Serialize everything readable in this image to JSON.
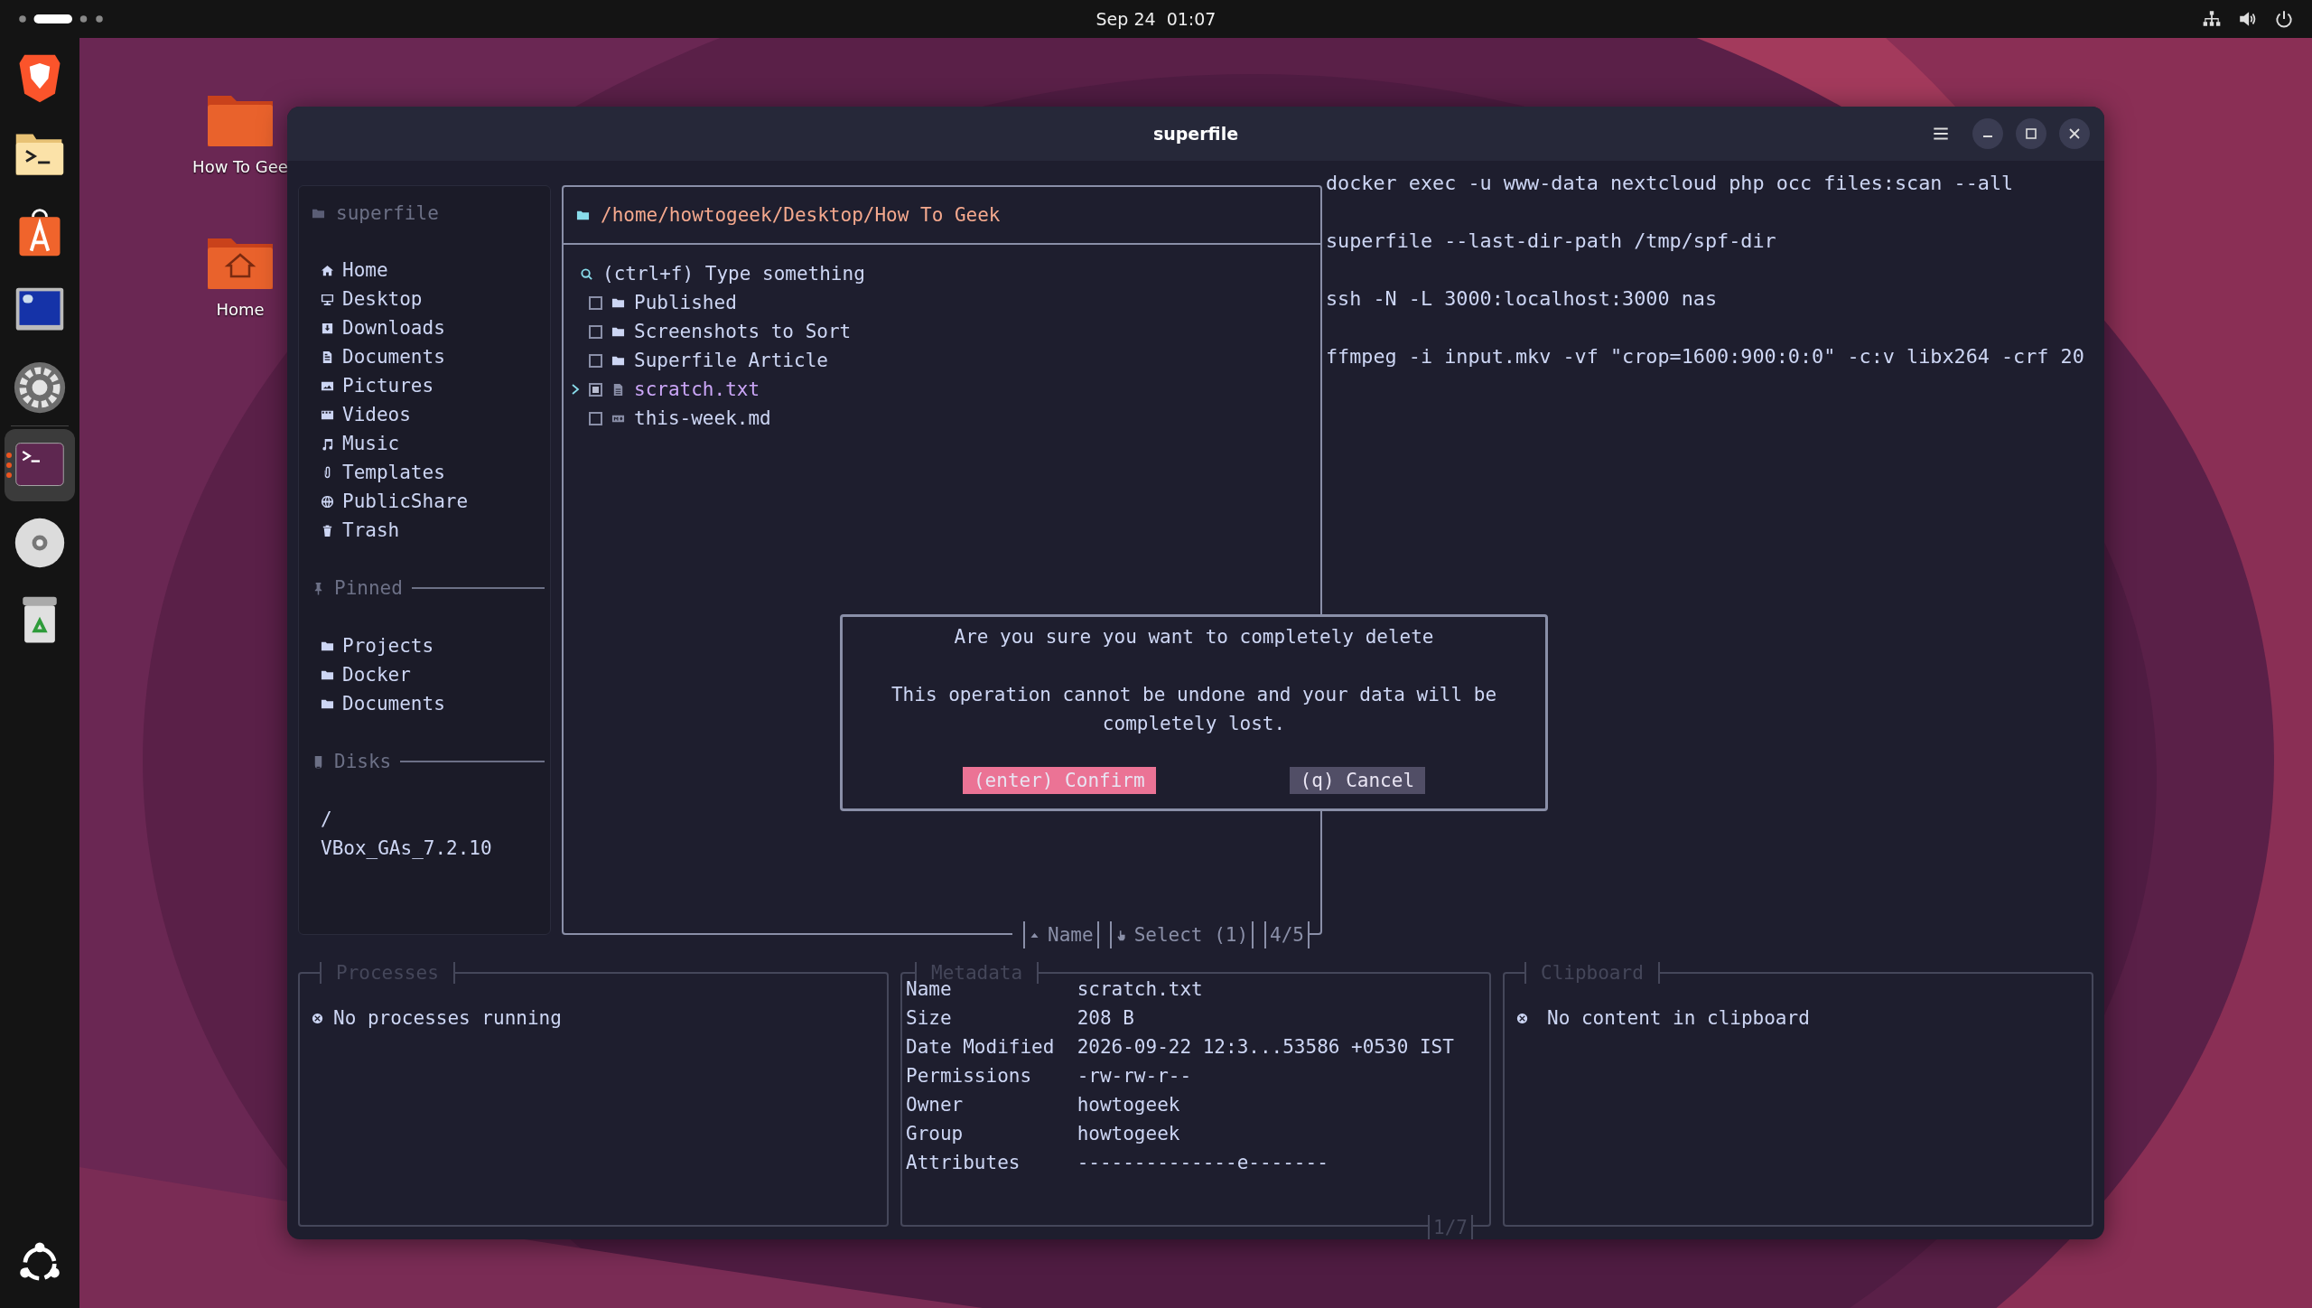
{
  "top_bar": {
    "clock": "Sep 24  01:07"
  },
  "dock": [
    {
      "kind": "shield",
      "running": false
    },
    {
      "kind": "terminal-folder",
      "running": false
    },
    {
      "kind": "bag",
      "running": false
    },
    {
      "kind": "monitor",
      "running": false
    },
    {
      "kind": "gear",
      "running": false
    },
    {
      "kind": "terminal",
      "running": true
    },
    {
      "kind": "disc",
      "running": false
    },
    {
      "kind": "trash",
      "running": false
    }
  ],
  "desktop_icons": [
    {
      "label": "How To Gee",
      "kind": "folder"
    },
    {
      "label": "Home",
      "kind": "home-folder"
    }
  ],
  "window": {
    "title": "superfile"
  },
  "sidebar": {
    "title": "superfile",
    "items": [
      {
        "label": "Home",
        "kind": "home"
      },
      {
        "label": "Desktop",
        "kind": "desktop"
      },
      {
        "label": "Downloads",
        "kind": "downloads"
      },
      {
        "label": "Documents",
        "kind": "documents"
      },
      {
        "label": "Pictures",
        "kind": "pictures"
      },
      {
        "label": "Videos",
        "kind": "videos"
      },
      {
        "label": "Music",
        "kind": "music"
      },
      {
        "label": "Templates",
        "kind": "templates"
      },
      {
        "label": "PublicShare",
        "kind": "publicshare"
      },
      {
        "label": "Trash",
        "kind": "trash"
      }
    ],
    "pinned_title": "Pinned",
    "pinned": [
      "Projects",
      "Docker",
      "Documents"
    ],
    "disks_title": "Disks",
    "disks": [
      "/",
      "VBox_GAs_7.2.10"
    ]
  },
  "file_panel": {
    "path": "/home/howtogeek/Desktop/How To Geek",
    "search_placeholder": "(ctrl+f) Type something",
    "files": [
      {
        "name": "Published",
        "kind": "folder",
        "selected": false,
        "focused": false
      },
      {
        "name": "Screenshots to Sort",
        "kind": "folder",
        "selected": false,
        "focused": false
      },
      {
        "name": "Superfile Article",
        "kind": "folder",
        "selected": false,
        "focused": false
      },
      {
        "name": "scratch.txt",
        "kind": "text",
        "selected": true,
        "focused": true
      },
      {
        "name": "this-week.md",
        "kind": "markdown",
        "selected": false,
        "focused": false
      }
    ],
    "sort": "Name",
    "select_mode": "Select (1)",
    "count": "4/5"
  },
  "terminal_lines": [
    "docker exec -u www-data nextcloud php occ files:scan --all",
    "superfile --last-dir-path /tmp/spf-dir",
    "ssh -N -L 3000:localhost:3000 nas",
    "ffmpeg -i input.mkv -vf \"crop=1600:900:0:0\" -c:v libx264 -crf 20"
  ],
  "processes": {
    "title": "Processes",
    "message": "No processes running"
  },
  "metadata": {
    "title": "Metadata",
    "rows": [
      {
        "label": "Name",
        "value": "scratch.txt"
      },
      {
        "label": "Size",
        "value": "208 B"
      },
      {
        "label": "Date Modified",
        "value": "2026-09-22 12:3...53586 +0530 IST"
      },
      {
        "label": "Permissions",
        "value": "-rw-rw-r--"
      },
      {
        "label": "Owner",
        "value": "howtogeek"
      },
      {
        "label": "Group",
        "value": "howtogeek"
      },
      {
        "label": "Attributes",
        "value": "--------------e-------"
      }
    ],
    "page": "1/7"
  },
  "clipboard": {
    "title": "Clipboard",
    "message": "No content in clipboard"
  },
  "dialog": {
    "title": "Are you sure you want to completely delete",
    "message": "This operation cannot be undone and your data will be completely lost.",
    "buttons": [
      {
        "label": "(enter) Confirm",
        "kind": "confirm"
      },
      {
        "label": "(q) Cancel",
        "kind": "cancel"
      }
    ]
  }
}
